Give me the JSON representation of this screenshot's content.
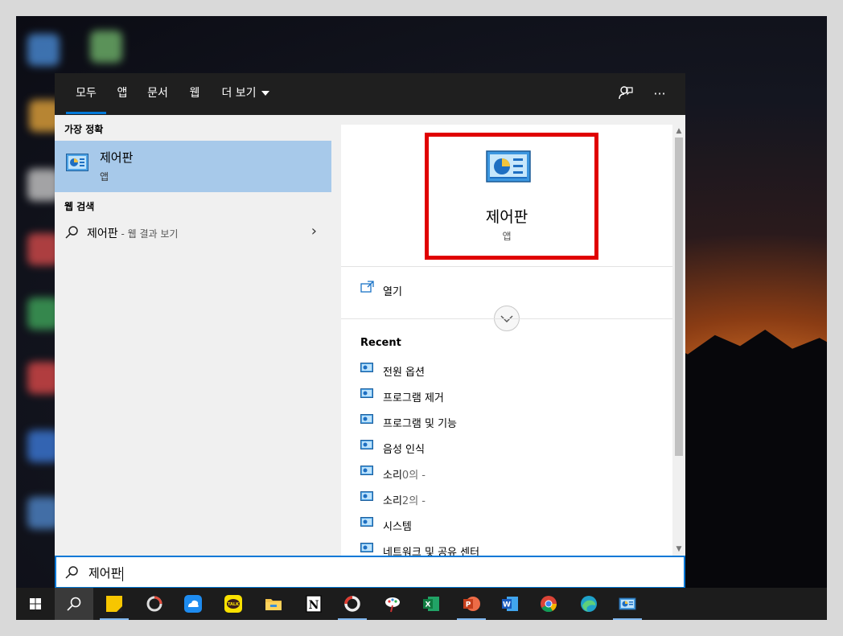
{
  "tabs": [
    {
      "label": "모두",
      "active": true
    },
    {
      "label": "앱"
    },
    {
      "label": "문서"
    },
    {
      "label": "웹"
    },
    {
      "label": "더 보기"
    }
  ],
  "top_icons": [
    "feedback-icon",
    "more-icon"
  ],
  "more_icon_glyph": "···",
  "best_match": {
    "header": "가장 정확",
    "title": "제어판",
    "subtitle": "앱"
  },
  "web_search": {
    "header": "웹 검색",
    "query": "제어판",
    "hint": " - 웹 결과 보기"
  },
  "detail": {
    "title": "제어판",
    "subtitle": "앱",
    "open_label": "열기",
    "recent_header": "Recent",
    "recent": [
      {
        "label": "전원 옵션",
        "dim": ""
      },
      {
        "label": "프로그램 제거",
        "dim": ""
      },
      {
        "label": "프로그램 및 기능",
        "dim": ""
      },
      {
        "label": "음성 인식",
        "dim": ""
      },
      {
        "label": "소리",
        "dim": "0의 -"
      },
      {
        "label": "소리",
        "dim": "2의 -"
      },
      {
        "label": "시스템",
        "dim": ""
      },
      {
        "label": "네트워크 및 공유 센터",
        "dim": ""
      }
    ]
  },
  "search_box": {
    "value": "제어판"
  },
  "taskbar": {
    "apps": [
      {
        "icon": "start-icon"
      },
      {
        "icon": "search-icon",
        "active": true
      },
      {
        "icon": "sticky-notes-icon",
        "running": true
      },
      {
        "icon": "capture-app-icon"
      },
      {
        "icon": "cloud-drive-icon"
      },
      {
        "icon": "kakaotalk-icon",
        "text": "TALK"
      },
      {
        "icon": "file-explorer-icon"
      },
      {
        "icon": "notion-icon",
        "text": "N"
      },
      {
        "icon": "ring-app-icon",
        "running": true
      },
      {
        "icon": "paint-app-icon"
      },
      {
        "icon": "excel-icon",
        "text": "X"
      },
      {
        "icon": "powerpoint-icon",
        "text": "P",
        "running": true
      },
      {
        "icon": "word-icon",
        "text": "W"
      },
      {
        "icon": "chrome-icon"
      },
      {
        "icon": "edge-icon"
      },
      {
        "icon": "control-panel-taskbar-icon",
        "running": true
      }
    ]
  },
  "colors": {
    "accent": "#0078d7",
    "selection": "#a7c9ea",
    "highlight_box": "#e00000",
    "topbar": "#1f1f1f",
    "taskbar": "#1c1c1c"
  }
}
